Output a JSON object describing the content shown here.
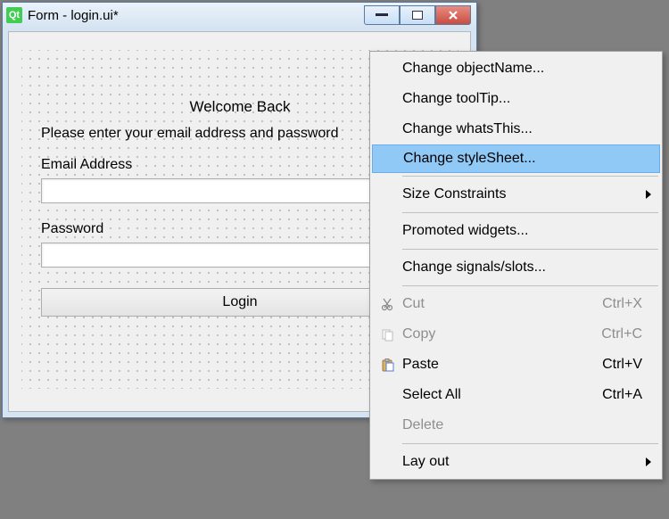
{
  "window": {
    "title": "Form - login.ui*"
  },
  "form": {
    "heading": "Welcome Back",
    "subheading": "Please enter your email address and password",
    "email_label": "Email Address",
    "email_value": "",
    "password_label": "Password",
    "password_value": "",
    "login_label": "Login"
  },
  "menu": {
    "items": [
      {
        "label": "Change objectName...",
        "enabled": true
      },
      {
        "label": "Change toolTip...",
        "enabled": true
      },
      {
        "label": "Change whatsThis...",
        "enabled": true
      },
      {
        "label": "Change styleSheet...",
        "enabled": true,
        "highlight": true
      },
      {
        "sep": true
      },
      {
        "label": "Size Constraints",
        "enabled": true,
        "submenu": true
      },
      {
        "sep": true
      },
      {
        "label": "Promoted widgets...",
        "enabled": true
      },
      {
        "sep": true
      },
      {
        "label": "Change signals/slots...",
        "enabled": true
      },
      {
        "sep": true
      },
      {
        "label": "Cut",
        "enabled": false,
        "shortcut": "Ctrl+X",
        "icon": "cut-icon"
      },
      {
        "label": "Copy",
        "enabled": false,
        "shortcut": "Ctrl+C",
        "icon": "copy-icon"
      },
      {
        "label": "Paste",
        "enabled": true,
        "shortcut": "Ctrl+V",
        "icon": "paste-icon"
      },
      {
        "label": "Select All",
        "enabled": true,
        "shortcut": "Ctrl+A"
      },
      {
        "label": "Delete",
        "enabled": false
      },
      {
        "sep": true
      },
      {
        "label": "Lay out",
        "enabled": true,
        "submenu": true
      }
    ]
  }
}
